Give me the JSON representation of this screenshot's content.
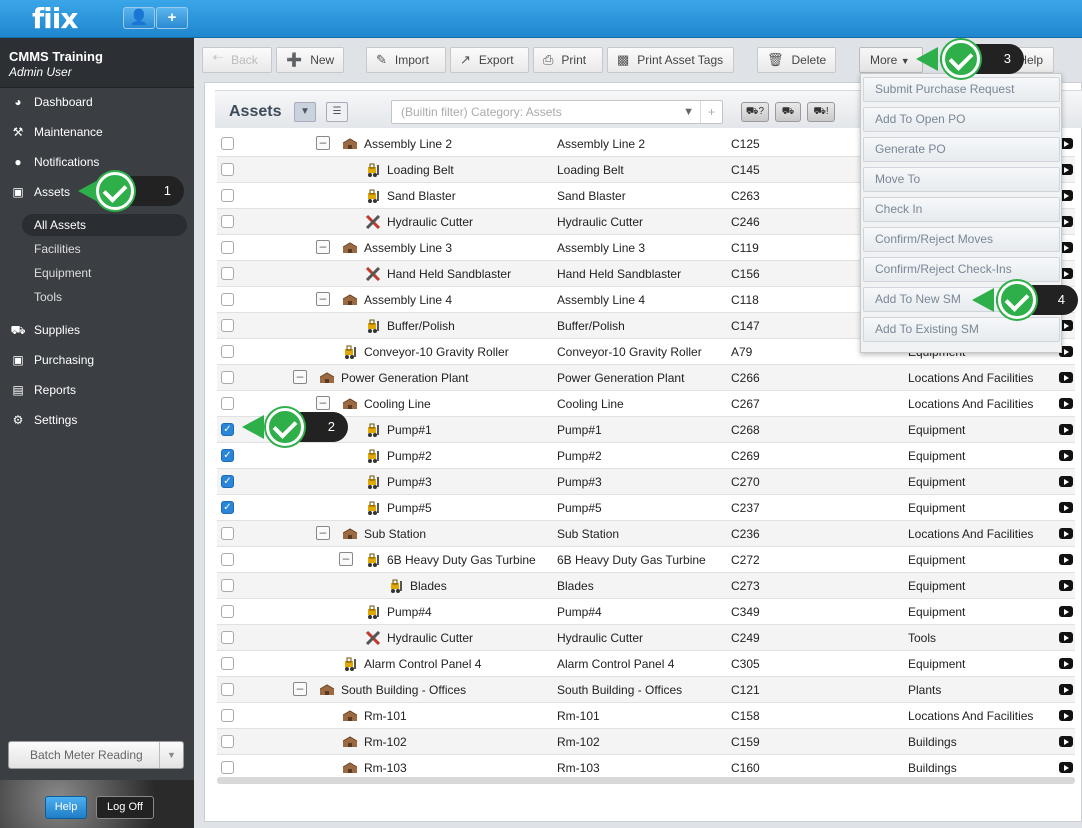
{
  "app": {
    "logo": "fiix",
    "user_icon": "user-icon",
    "add_label": "+"
  },
  "sidebar": {
    "org": "CMMS Training",
    "user": "Admin User",
    "nav": [
      {
        "label": "Dashboard",
        "icon": "dashboard-icon"
      },
      {
        "label": "Maintenance",
        "icon": "wrench-icon"
      },
      {
        "label": "Notifications",
        "icon": "chat-icon"
      },
      {
        "label": "Assets",
        "icon": "box-icon"
      },
      {
        "label": "Supplies",
        "icon": "truck-icon"
      },
      {
        "label": "Purchasing",
        "icon": "cart-icon"
      },
      {
        "label": "Reports",
        "icon": "chart-icon"
      },
      {
        "label": "Settings",
        "icon": "gear-icon"
      }
    ],
    "asset_sub": [
      "All Assets",
      "Facilities",
      "Equipment",
      "Tools"
    ],
    "batch": "Batch Meter Reading",
    "help": "Help",
    "logoff": "Log Off"
  },
  "toolbar": {
    "back": "Back",
    "new": "New",
    "import": "Import",
    "export": "Export",
    "print": "Print",
    "print_tags": "Print Asset Tags",
    "delete": "Delete",
    "more": "More",
    "help": "Help"
  },
  "panel": {
    "title": "Assets",
    "filter_placeholder": "(Builtin filter) Category: Assets",
    "filter_plus": "+"
  },
  "more_menu": [
    "Submit Purchase Request",
    "Add To Open PO",
    "Generate PO",
    "Move To",
    "Check In",
    "Confirm/Reject Moves",
    "Confirm/Reject Check-Ins",
    "Add To New SM",
    "Add To Existing SM"
  ],
  "rows": [
    {
      "name": "Assembly Line 2",
      "n2": "Assembly Line 2",
      "code": "C125",
      "cat": "",
      "indent": 3,
      "tog": true,
      "icon": "building",
      "checked": false
    },
    {
      "name": "Loading Belt",
      "n2": "Loading Belt",
      "code": "C145",
      "cat": "",
      "indent": 4,
      "tog": false,
      "icon": "forklift",
      "checked": false
    },
    {
      "name": "Sand Blaster",
      "n2": "Sand Blaster",
      "code": "C263",
      "cat": "",
      "indent": 4,
      "tog": false,
      "icon": "forklift",
      "checked": false
    },
    {
      "name": "Hydraulic Cutter",
      "n2": "Hydraulic Cutter",
      "code": "C246",
      "cat": "",
      "indent": 4,
      "tog": false,
      "icon": "tools",
      "checked": false
    },
    {
      "name": "Assembly Line 3",
      "n2": "Assembly Line 3",
      "code": "C119",
      "cat": "",
      "indent": 3,
      "tog": true,
      "icon": "building",
      "checked": false
    },
    {
      "name": "Hand Held Sandblaster",
      "n2": "Hand Held Sandblaster",
      "code": "C156",
      "cat": "",
      "indent": 4,
      "tog": false,
      "icon": "tools",
      "checked": false
    },
    {
      "name": "Assembly Line 4",
      "n2": "Assembly Line 4",
      "code": "C118",
      "cat": "",
      "indent": 3,
      "tog": true,
      "icon": "building",
      "checked": false
    },
    {
      "name": "Buffer/Polish",
      "n2": "Buffer/Polish",
      "code": "C147",
      "cat": "",
      "indent": 4,
      "tog": false,
      "icon": "forklift",
      "checked": false
    },
    {
      "name": "Conveyor-10 Gravity Roller",
      "n2": "Conveyor-10 Gravity Roller",
      "code": "A79",
      "cat": "Equipment",
      "indent": 3,
      "tog": false,
      "icon": "forklift",
      "checked": false
    },
    {
      "name": "Power Generation Plant",
      "n2": "Power Generation Plant",
      "code": "C266",
      "cat": "Locations And Facilities",
      "indent": 2,
      "tog": true,
      "icon": "building",
      "checked": false
    },
    {
      "name": "Cooling Line",
      "n2": "Cooling Line",
      "code": "C267",
      "cat": "Locations And Facilities",
      "indent": 3,
      "tog": true,
      "icon": "building",
      "checked": false
    },
    {
      "name": "Pump#1",
      "n2": "Pump#1",
      "code": "C268",
      "cat": "Equipment",
      "indent": 4,
      "tog": false,
      "icon": "forklift",
      "checked": true
    },
    {
      "name": "Pump#2",
      "n2": "Pump#2",
      "code": "C269",
      "cat": "Equipment",
      "indent": 4,
      "tog": false,
      "icon": "forklift",
      "checked": true
    },
    {
      "name": "Pump#3",
      "n2": "Pump#3",
      "code": "C270",
      "cat": "Equipment",
      "indent": 4,
      "tog": false,
      "icon": "forklift",
      "checked": true
    },
    {
      "name": "Pump#5",
      "n2": "Pump#5",
      "code": "C237",
      "cat": "Equipment",
      "indent": 4,
      "tog": false,
      "icon": "forklift",
      "checked": true
    },
    {
      "name": "Sub Station",
      "n2": "Sub Station",
      "code": "C236",
      "cat": "Locations And Facilities",
      "indent": 3,
      "tog": true,
      "icon": "building",
      "checked": false
    },
    {
      "name": "6B Heavy Duty Gas Turbine",
      "n2": "6B Heavy Duty Gas Turbine",
      "code": "C272",
      "cat": "Equipment",
      "indent": 4,
      "tog": true,
      "icon": "forklift",
      "checked": false
    },
    {
      "name": "Blades",
      "n2": "Blades",
      "code": "C273",
      "cat": "Equipment",
      "indent": 5,
      "tog": false,
      "icon": "forklift",
      "checked": false
    },
    {
      "name": "Pump#4",
      "n2": "Pump#4",
      "code": "C349",
      "cat": "Equipment",
      "indent": 4,
      "tog": false,
      "icon": "forklift",
      "checked": false
    },
    {
      "name": "Hydraulic Cutter",
      "n2": "Hydraulic Cutter",
      "code": "C249",
      "cat": "Tools",
      "indent": 4,
      "tog": false,
      "icon": "tools",
      "checked": false
    },
    {
      "name": "Alarm Control Panel 4",
      "n2": "Alarm Control Panel 4",
      "code": "C305",
      "cat": "Equipment",
      "indent": 3,
      "tog": false,
      "icon": "forklift",
      "checked": false
    },
    {
      "name": "South Building - Offices",
      "n2": "South Building - Offices",
      "code": "C121",
      "cat": "Plants",
      "indent": 2,
      "tog": true,
      "icon": "building",
      "checked": false
    },
    {
      "name": "Rm-101",
      "n2": "Rm-101",
      "code": "C158",
      "cat": "Locations And Facilities",
      "indent": 3,
      "tog": false,
      "icon": "building",
      "checked": false
    },
    {
      "name": "Rm-102",
      "n2": "Rm-102",
      "code": "C159",
      "cat": "Buildings",
      "indent": 3,
      "tog": false,
      "icon": "building",
      "checked": false
    },
    {
      "name": "Rm-103",
      "n2": "Rm-103",
      "code": "C160",
      "cat": "Buildings",
      "indent": 3,
      "tog": false,
      "icon": "building",
      "checked": false
    }
  ],
  "callouts": [
    "1",
    "2",
    "3",
    "4"
  ],
  "colors": {
    "accent": "#1f86cf",
    "callout_green": "#2eaf4a",
    "check_blue": "#2b86d9"
  }
}
